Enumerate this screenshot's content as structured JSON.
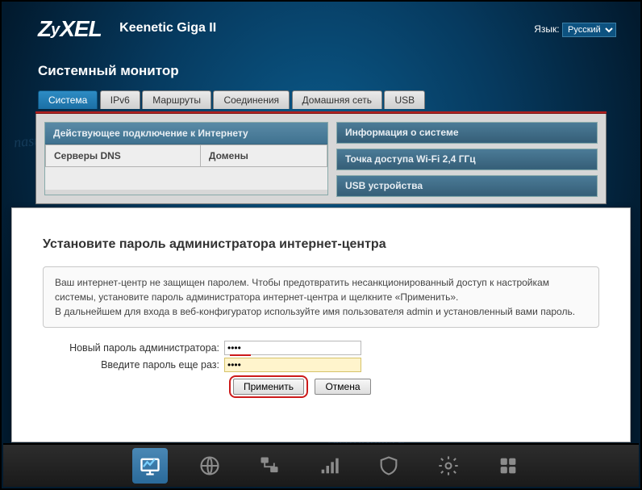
{
  "brand": {
    "part1": "Z",
    "part2": "y",
    "part3": "XEL"
  },
  "product": "Keenetic Giga II",
  "language": {
    "label": "Язык:",
    "selected": "Русский"
  },
  "page_title": "Системный монитор",
  "tabs": [
    {
      "label": "Система",
      "active": true
    },
    {
      "label": "IPv6",
      "active": false
    },
    {
      "label": "Маршруты",
      "active": false
    },
    {
      "label": "Соединения",
      "active": false
    },
    {
      "label": "Домашняя сеть",
      "active": false
    },
    {
      "label": "USB",
      "active": false
    }
  ],
  "left_panel": {
    "title": "Действующее подключение к Интернету",
    "cols": {
      "dns": "Серверы DNS",
      "domains": "Домены"
    }
  },
  "right_panels": [
    "Информация о системе",
    "Точка доступа Wi-Fi 2,4 ГГц",
    "USB устройства"
  ],
  "modal": {
    "title": "Установите пароль администратора интернет-центра",
    "info_p1": "Ваш интернет-центр не защищен паролем. Чтобы предотвратить несанкционированный доступ к настройкам системы, установите пароль администратора интернет-центра и щелкните «Применить».",
    "info_p2": "В дальнейшем для входа в веб-конфигуратор используйте имя пользователя admin и установленный вами пароль.",
    "label_new": "Новый пароль администратора:",
    "label_repeat": "Введите пароль еще раз:",
    "value_new": "••••",
    "value_repeat": "••••",
    "btn_apply": "Применить",
    "btn_cancel": "Отмена"
  },
  "nav": [
    {
      "name": "monitor-icon",
      "active": true
    },
    {
      "name": "globe-icon",
      "active": false
    },
    {
      "name": "network-icon",
      "active": false
    },
    {
      "name": "wifi-icon",
      "active": false
    },
    {
      "name": "shield-icon",
      "active": false
    },
    {
      "name": "gear-icon",
      "active": false
    },
    {
      "name": "apps-icon",
      "active": false
    }
  ]
}
